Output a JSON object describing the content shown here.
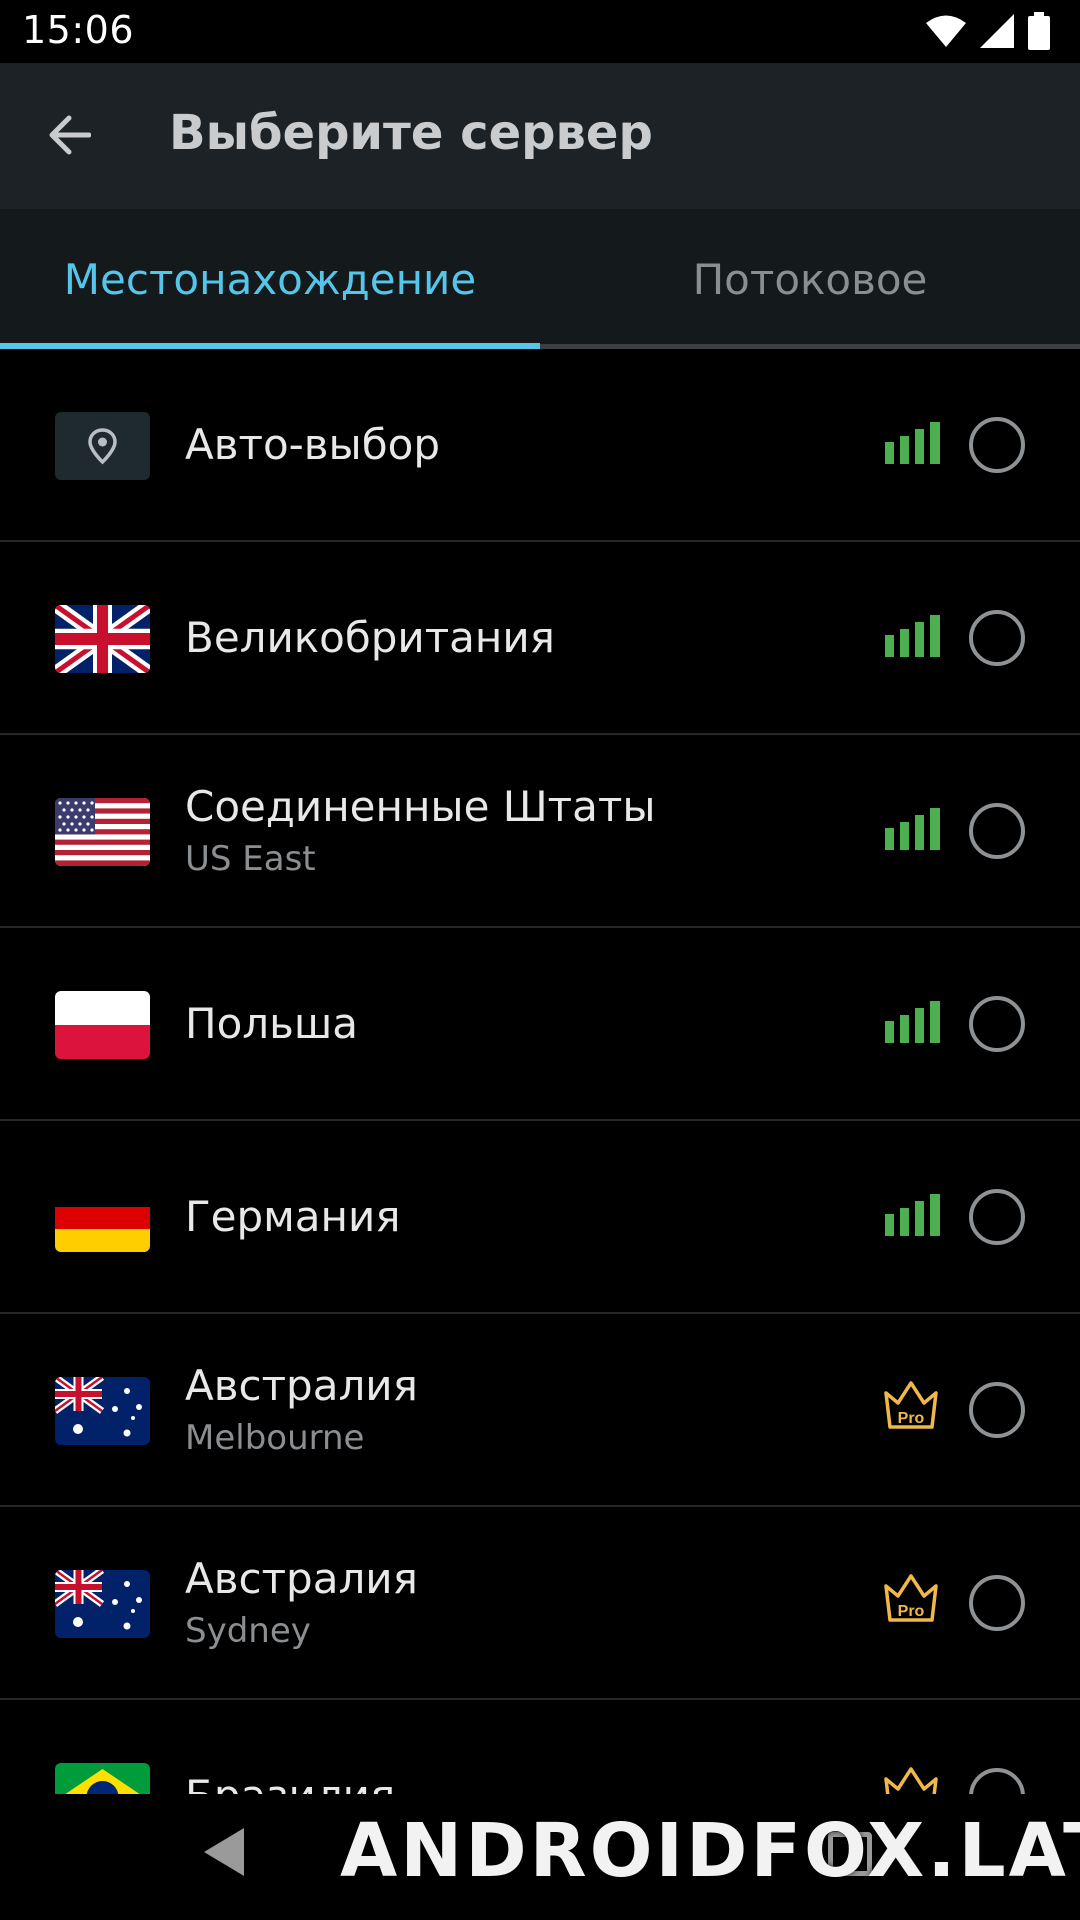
{
  "status_bar": {
    "time": "15:06"
  },
  "app_bar": {
    "title": "Выберите сервер"
  },
  "tabs": [
    {
      "label": "Местонахождение",
      "active": true
    },
    {
      "label": "Потоковое",
      "active": false
    }
  ],
  "colors": {
    "accent": "#55c5ea",
    "signal": "#4caf50",
    "pro": "#f0b84a"
  },
  "servers": [
    {
      "name": "Авто-выбор",
      "city": "",
      "icon": "location-pin-icon",
      "status": "signal"
    },
    {
      "name": "Великобритания",
      "city": "",
      "icon": "flag-uk-icon",
      "status": "signal"
    },
    {
      "name": "Соединенные Штаты",
      "city": "US East",
      "icon": "flag-us-icon",
      "status": "signal"
    },
    {
      "name": "Польша",
      "city": "",
      "icon": "flag-pl-icon",
      "status": "signal"
    },
    {
      "name": "Германия",
      "city": "",
      "icon": "flag-de-icon",
      "status": "signal"
    },
    {
      "name": "Австралия",
      "city": "Melbourne",
      "icon": "flag-au-icon",
      "status": "pro"
    },
    {
      "name": "Австралия",
      "city": "Sydney",
      "icon": "flag-au-icon",
      "status": "pro"
    },
    {
      "name": "Бразилия",
      "city": "",
      "icon": "flag-br-icon",
      "status": "pro"
    }
  ],
  "badges": {
    "pro_label": "Pro"
  },
  "watermark": "ANDROIDFOX.LAT"
}
